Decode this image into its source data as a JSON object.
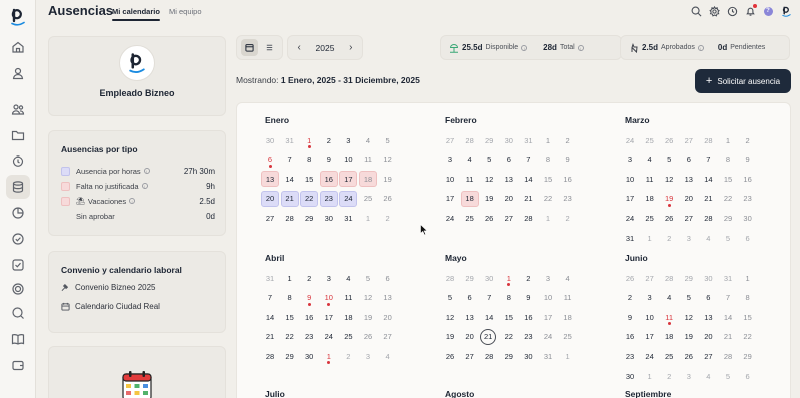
{
  "header": {
    "app_title": "Ausencias",
    "tabs": [
      {
        "label": "Mi calendario",
        "active": true
      },
      {
        "label": "Mi equipo",
        "active": false
      }
    ],
    "notification_dot": true,
    "help_label": "?"
  },
  "profile": {
    "name": "Empleado Bizneo"
  },
  "absence_types": {
    "title": "Ausencias por tipo",
    "items": [
      {
        "label": "Ausencia por horas",
        "value": "27h 30m",
        "color": "#dcdcf7",
        "info": true
      },
      {
        "label": "Falta no justificada",
        "value": "9h",
        "color": "#f7dada",
        "info": true
      },
      {
        "label": "Vacaciones",
        "value": "2.5d",
        "color": "#f7dada",
        "info": true,
        "emoji": "⛱"
      },
      {
        "label": "Sin aprobar",
        "value": "0d",
        "color": "#eceae5",
        "info": false
      }
    ]
  },
  "agreement": {
    "title": "Convenio y calendario laboral",
    "items": [
      {
        "label": "Convenio Bizneo 2025",
        "icon": "gavel-icon"
      },
      {
        "label": "Calendario Ciudad Real",
        "icon": "calendar-icon"
      }
    ]
  },
  "toolbar": {
    "year": "2025",
    "prev": "‹",
    "next": "›"
  },
  "stats": {
    "available_value": "25.5d",
    "available_label": "Disponible",
    "total_value": "28d",
    "total_label": "Total",
    "approved_value": "2.5d",
    "approved_label": "Aprobados",
    "pending_value": "0d",
    "pending_label": "Pendientes"
  },
  "range": {
    "prefix": "Mostrando:",
    "value": "1 Enero, 2025 - 31 Diciembre, 2025"
  },
  "request_button": {
    "label": "Solicitar ausencia"
  },
  "calendar": {
    "months": [
      {
        "name": "Enero",
        "weeks": [
          [
            [
              "30",
              "o"
            ],
            [
              "31",
              "o"
            ],
            [
              "1",
              "h"
            ],
            [
              "2",
              ""
            ],
            [
              "3",
              ""
            ],
            [
              "4",
              "w"
            ],
            [
              "5",
              "w"
            ]
          ],
          [
            [
              "6",
              "h"
            ],
            [
              "7",
              ""
            ],
            [
              "8",
              ""
            ],
            [
              "9",
              ""
            ],
            [
              "10",
              ""
            ],
            [
              "11",
              "w"
            ],
            [
              "12",
              "w"
            ]
          ],
          [
            [
              "13",
              "p"
            ],
            [
              "14",
              ""
            ],
            [
              "15",
              ""
            ],
            [
              "16",
              "p"
            ],
            [
              "17",
              "p"
            ],
            [
              "18",
              "pw"
            ],
            [
              "19",
              "w"
            ]
          ],
          [
            [
              "20",
              "b"
            ],
            [
              "21",
              "b"
            ],
            [
              "22",
              "b"
            ],
            [
              "23",
              "b"
            ],
            [
              "24",
              "b"
            ],
            [
              "25",
              "w"
            ],
            [
              "26",
              "w"
            ]
          ],
          [
            [
              "27",
              ""
            ],
            [
              "28",
              ""
            ],
            [
              "29",
              ""
            ],
            [
              "30",
              ""
            ],
            [
              "31",
              ""
            ],
            [
              "1",
              "o"
            ],
            [
              "2",
              "o"
            ]
          ]
        ]
      },
      {
        "name": "Febrero",
        "weeks": [
          [
            [
              "27",
              "o"
            ],
            [
              "28",
              "o"
            ],
            [
              "29",
              "o"
            ],
            [
              "30",
              "o"
            ],
            [
              "31",
              "o"
            ],
            [
              "1",
              "w"
            ],
            [
              "2",
              "w"
            ]
          ],
          [
            [
              "3",
              ""
            ],
            [
              "4",
              ""
            ],
            [
              "5",
              ""
            ],
            [
              "6",
              ""
            ],
            [
              "7",
              ""
            ],
            [
              "8",
              "w"
            ],
            [
              "9",
              "w"
            ]
          ],
          [
            [
              "10",
              ""
            ],
            [
              "11",
              ""
            ],
            [
              "12",
              ""
            ],
            [
              "13",
              ""
            ],
            [
              "14",
              ""
            ],
            [
              "15",
              "w"
            ],
            [
              "16",
              "w"
            ]
          ],
          [
            [
              "17",
              ""
            ],
            [
              "18",
              "p"
            ],
            [
              "19",
              ""
            ],
            [
              "20",
              ""
            ],
            [
              "21",
              ""
            ],
            [
              "22",
              "w"
            ],
            [
              "23",
              "w"
            ]
          ],
          [
            [
              "24",
              ""
            ],
            [
              "25",
              ""
            ],
            [
              "26",
              ""
            ],
            [
              "27",
              ""
            ],
            [
              "28",
              ""
            ],
            [
              "1",
              "o"
            ],
            [
              "2",
              "o"
            ]
          ]
        ]
      },
      {
        "name": "Marzo",
        "weeks": [
          [
            [
              "24",
              "o"
            ],
            [
              "25",
              "o"
            ],
            [
              "26",
              "o"
            ],
            [
              "27",
              "o"
            ],
            [
              "28",
              "o"
            ],
            [
              "1",
              "w"
            ],
            [
              "2",
              "w"
            ]
          ],
          [
            [
              "3",
              ""
            ],
            [
              "4",
              ""
            ],
            [
              "5",
              ""
            ],
            [
              "6",
              ""
            ],
            [
              "7",
              ""
            ],
            [
              "8",
              "w"
            ],
            [
              "9",
              "w"
            ]
          ],
          [
            [
              "10",
              ""
            ],
            [
              "11",
              ""
            ],
            [
              "12",
              ""
            ],
            [
              "13",
              ""
            ],
            [
              "14",
              ""
            ],
            [
              "15",
              "w"
            ],
            [
              "16",
              "w"
            ]
          ],
          [
            [
              "17",
              ""
            ],
            [
              "18",
              ""
            ],
            [
              "19",
              "h"
            ],
            [
              "20",
              ""
            ],
            [
              "21",
              ""
            ],
            [
              "22",
              "w"
            ],
            [
              "23",
              "w"
            ]
          ],
          [
            [
              "24",
              ""
            ],
            [
              "25",
              ""
            ],
            [
              "26",
              ""
            ],
            [
              "27",
              ""
            ],
            [
              "28",
              ""
            ],
            [
              "29",
              "w"
            ],
            [
              "30",
              "w"
            ]
          ],
          [
            [
              "31",
              ""
            ],
            [
              "1",
              "o"
            ],
            [
              "2",
              "o"
            ],
            [
              "3",
              "o"
            ],
            [
              "4",
              "o"
            ],
            [
              "5",
              "o"
            ],
            [
              "6",
              "o"
            ]
          ]
        ]
      },
      {
        "name": "Abril",
        "weeks": [
          [
            [
              "31",
              "o"
            ],
            [
              "1",
              ""
            ],
            [
              "2",
              ""
            ],
            [
              "3",
              ""
            ],
            [
              "4",
              ""
            ],
            [
              "5",
              "w"
            ],
            [
              "6",
              "w"
            ]
          ],
          [
            [
              "7",
              ""
            ],
            [
              "8",
              ""
            ],
            [
              "9",
              "h"
            ],
            [
              "10",
              "h"
            ],
            [
              "11",
              ""
            ],
            [
              "12",
              "w"
            ],
            [
              "13",
              "w"
            ]
          ],
          [
            [
              "14",
              ""
            ],
            [
              "15",
              ""
            ],
            [
              "16",
              ""
            ],
            [
              "17",
              ""
            ],
            [
              "18",
              ""
            ],
            [
              "19",
              "w"
            ],
            [
              "20",
              "w"
            ]
          ],
          [
            [
              "21",
              ""
            ],
            [
              "22",
              ""
            ],
            [
              "23",
              ""
            ],
            [
              "24",
              ""
            ],
            [
              "25",
              ""
            ],
            [
              "26",
              "w"
            ],
            [
              "27",
              "w"
            ]
          ],
          [
            [
              "28",
              ""
            ],
            [
              "29",
              ""
            ],
            [
              "30",
              ""
            ],
            [
              "1",
              "oh"
            ],
            [
              "2",
              "o"
            ],
            [
              "3",
              "o"
            ],
            [
              "4",
              "o"
            ]
          ]
        ]
      },
      {
        "name": "Mayo",
        "weeks": [
          [
            [
              "28",
              "o"
            ],
            [
              "29",
              "o"
            ],
            [
              "30",
              "o"
            ],
            [
              "1",
              "h"
            ],
            [
              "2",
              ""
            ],
            [
              "3",
              "w"
            ],
            [
              "4",
              "w"
            ]
          ],
          [
            [
              "5",
              ""
            ],
            [
              "6",
              ""
            ],
            [
              "7",
              ""
            ],
            [
              "8",
              ""
            ],
            [
              "9",
              ""
            ],
            [
              "10",
              "w"
            ],
            [
              "11",
              "w"
            ]
          ],
          [
            [
              "12",
              ""
            ],
            [
              "13",
              ""
            ],
            [
              "14",
              ""
            ],
            [
              "15",
              ""
            ],
            [
              "16",
              ""
            ],
            [
              "17",
              "w"
            ],
            [
              "18",
              "w"
            ]
          ],
          [
            [
              "19",
              ""
            ],
            [
              "20",
              ""
            ],
            [
              "21",
              "t"
            ],
            [
              "22",
              ""
            ],
            [
              "23",
              ""
            ],
            [
              "24",
              "w"
            ],
            [
              "25",
              "w"
            ]
          ],
          [
            [
              "26",
              ""
            ],
            [
              "27",
              ""
            ],
            [
              "28",
              ""
            ],
            [
              "29",
              ""
            ],
            [
              "30",
              ""
            ],
            [
              "31",
              "w"
            ],
            [
              "1",
              "o"
            ]
          ]
        ]
      },
      {
        "name": "Junio",
        "weeks": [
          [
            [
              "26",
              "o"
            ],
            [
              "27",
              "o"
            ],
            [
              "28",
              "o"
            ],
            [
              "29",
              "o"
            ],
            [
              "30",
              "o"
            ],
            [
              "31",
              "o"
            ],
            [
              "1",
              "w"
            ]
          ],
          [
            [
              "2",
              ""
            ],
            [
              "3",
              ""
            ],
            [
              "4",
              ""
            ],
            [
              "5",
              ""
            ],
            [
              "6",
              ""
            ],
            [
              "7",
              "w"
            ],
            [
              "8",
              "w"
            ]
          ],
          [
            [
              "9",
              ""
            ],
            [
              "10",
              ""
            ],
            [
              "11",
              "h"
            ],
            [
              "12",
              ""
            ],
            [
              "13",
              ""
            ],
            [
              "14",
              "w"
            ],
            [
              "15",
              "w"
            ]
          ],
          [
            [
              "16",
              ""
            ],
            [
              "17",
              ""
            ],
            [
              "18",
              ""
            ],
            [
              "19",
              ""
            ],
            [
              "20",
              ""
            ],
            [
              "21",
              "w"
            ],
            [
              "22",
              "w"
            ]
          ],
          [
            [
              "23",
              ""
            ],
            [
              "24",
              ""
            ],
            [
              "25",
              ""
            ],
            [
              "26",
              ""
            ],
            [
              "27",
              ""
            ],
            [
              "28",
              "w"
            ],
            [
              "29",
              "w"
            ]
          ],
          [
            [
              "30",
              ""
            ],
            [
              "1",
              "o"
            ],
            [
              "2",
              "o"
            ],
            [
              "3",
              "o"
            ],
            [
              "4",
              "o"
            ],
            [
              "5",
              "o"
            ],
            [
              "6",
              "o"
            ]
          ]
        ]
      },
      {
        "name": "Julio",
        "weeks": []
      },
      {
        "name": "Agosto",
        "weeks": []
      },
      {
        "name": "Septiembre",
        "weeks": []
      }
    ]
  },
  "colors": {
    "primary": "#1e2a3b",
    "holiday": "#d8353d",
    "pink": "#f7dada",
    "blue": "#dcdcf7"
  }
}
